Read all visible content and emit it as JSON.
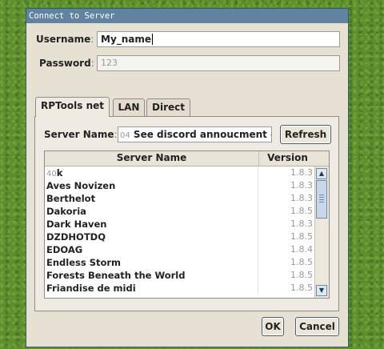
{
  "window": {
    "title": "Connect to Server"
  },
  "form": {
    "username_label": "Username",
    "username_value": "My_name",
    "password_label": "Password",
    "password_value": "123",
    "colon": ":"
  },
  "tabs": [
    {
      "label": "RPTools net",
      "active": true
    },
    {
      "label": "LAN",
      "active": false
    },
    {
      "label": "Direct",
      "active": false
    }
  ],
  "rptools": {
    "server_name_label": "Server Name",
    "server_name_prefix": "04",
    "server_name_value": "See discord annoucment cl",
    "refresh_label": "Refresh"
  },
  "table": {
    "columns": [
      "Server Name",
      "Version"
    ],
    "first_row_prefix": "40",
    "rows": [
      {
        "name": "k",
        "version": "1.8.3"
      },
      {
        "name": "Aves Novizen",
        "version": "1.8.3"
      },
      {
        "name": "Berthelot",
        "version": "1.8.3"
      },
      {
        "name": "Dakoria",
        "version": "1.8.5"
      },
      {
        "name": "Dark Haven",
        "version": "1.8.3"
      },
      {
        "name": "DZDHOTDQ",
        "version": "1.8.5"
      },
      {
        "name": "EDOAG",
        "version": "1.8.4"
      },
      {
        "name": "Endless Storm",
        "version": "1.8.5"
      },
      {
        "name": "Forests Beneath the World",
        "version": "1.8.5"
      },
      {
        "name": "Friandise de midi",
        "version": "1.8.5"
      }
    ]
  },
  "buttons": {
    "ok": "OK",
    "cancel": "Cancel"
  },
  "icons": {
    "scroll_up": "scroll-up-arrow-icon",
    "scroll_down": "scroll-down-arrow-icon"
  }
}
